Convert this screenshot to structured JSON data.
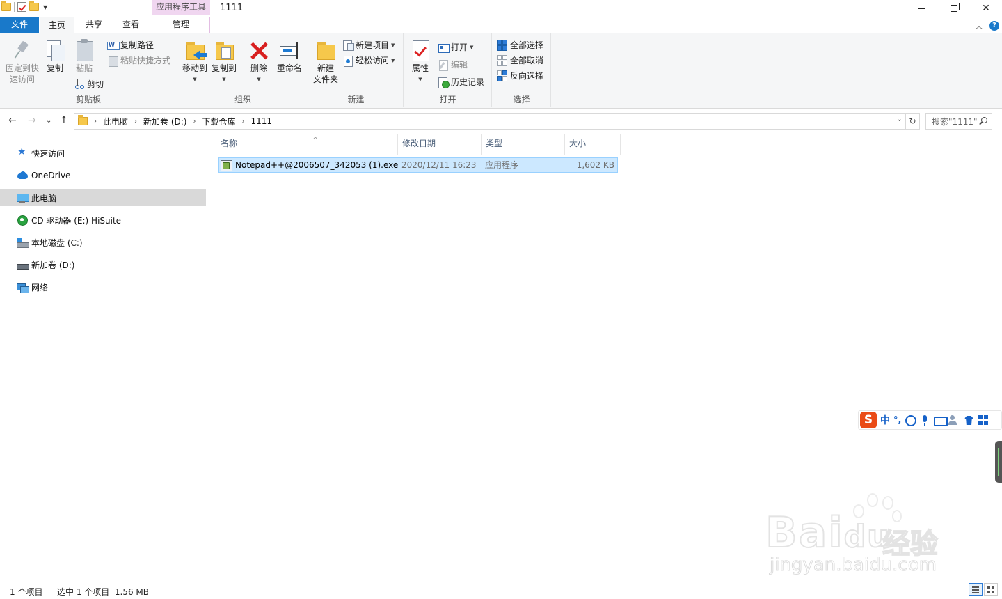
{
  "window": {
    "title": "1111",
    "context_tab_header": "应用程序工具"
  },
  "tabs": {
    "file": "文件",
    "home": "主页",
    "share": "共享",
    "view": "查看",
    "manage": "管理"
  },
  "ribbon": {
    "clipboard": {
      "label": "剪贴板",
      "pin": "固定到快\n速访问",
      "pin_l1": "固定到快",
      "pin_l2": "速访问",
      "copy": "复制",
      "paste": "粘贴",
      "copy_path": "复制路径",
      "paste_shortcut": "粘贴快捷方式",
      "cut": "剪切"
    },
    "organize": {
      "label": "组织",
      "move_to": "移动到",
      "copy_to": "复制到",
      "delete": "删除",
      "rename": "重命名"
    },
    "new": {
      "label": "新建",
      "new_folder_l1": "新建",
      "new_folder_l2": "文件夹",
      "new_item": "新建项目",
      "easy_access": "轻松访问"
    },
    "open": {
      "label": "打开",
      "properties": "属性",
      "open": "打开",
      "edit": "编辑",
      "history": "历史记录"
    },
    "select": {
      "label": "选择",
      "select_all": "全部选择",
      "select_none": "全部取消",
      "invert": "反向选择"
    }
  },
  "address": {
    "crumbs": [
      "此电脑",
      "新加卷 (D:)",
      "下载仓库",
      "1111"
    ],
    "search_placeholder": "搜索\"1111\""
  },
  "nav": {
    "items": [
      {
        "label": "快速访问"
      },
      {
        "label": "OneDrive"
      },
      {
        "label": "此电脑"
      },
      {
        "label": "CD 驱动器 (E:) HiSuite"
      },
      {
        "label": "本地磁盘 (C:)"
      },
      {
        "label": "新加卷 (D:)"
      },
      {
        "label": "网络"
      }
    ]
  },
  "columns": {
    "name": "名称",
    "date": "修改日期",
    "type": "类型",
    "size": "大小"
  },
  "files": [
    {
      "name": "Notepad++@2006507_342053 (1).exe",
      "date": "2020/12/11 16:23",
      "type": "应用程序",
      "size": "1,602 KB"
    }
  ],
  "status": {
    "count": "1 个项目",
    "selected": "选中 1 个项目  1.56 MB"
  },
  "ime": {
    "lang": "中",
    "punct": "°,"
  },
  "watermark": {
    "brand": "Bai",
    "brand2": "du",
    "cn": "经验",
    "url": "jingyan.baidu.com"
  }
}
